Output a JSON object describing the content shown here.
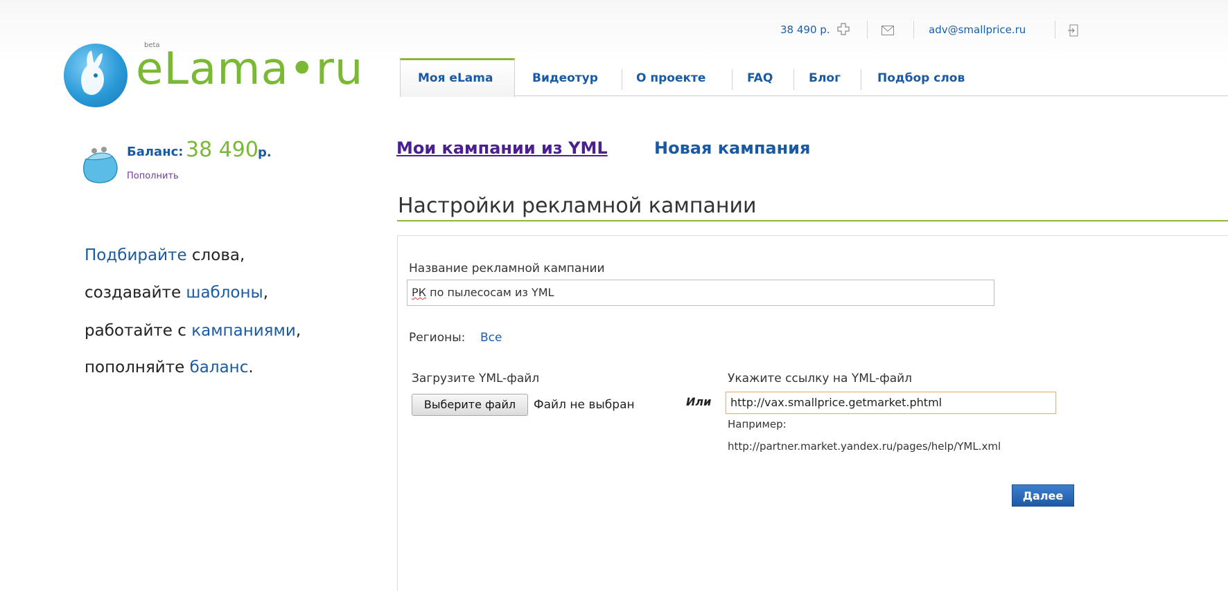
{
  "header": {
    "balance_link": "38 490 р.",
    "email": "adv@smallprice.ru"
  },
  "logo": {
    "text": "eLama•ru",
    "badge": "beta"
  },
  "nav": {
    "tabs": [
      {
        "label": "Моя eLama",
        "active": true
      },
      {
        "label": "Видеотур"
      },
      {
        "label": "О проекте"
      },
      {
        "label": "FAQ"
      },
      {
        "label": "Блог"
      },
      {
        "label": "Подбор слов"
      }
    ]
  },
  "sidebar": {
    "balance_label": "Баланс:",
    "balance_value": "38 490",
    "balance_currency": "р.",
    "topup_label": "Пополнить",
    "promo": [
      {
        "pre": "",
        "link": "Подбирайте",
        "post": " слова,"
      },
      {
        "pre": "создавайте ",
        "link": "шаблоны",
        "post": ","
      },
      {
        "pre": "работайте с ",
        "link": "кампаниями",
        "post": ","
      },
      {
        "pre": "пополняйте ",
        "link": "баланс",
        "post": "."
      }
    ]
  },
  "subnav": {
    "active": "Мои кампании из YML",
    "new_campaign": "Новая кампания"
  },
  "page": {
    "title": "Настройки рекламной кампании"
  },
  "form": {
    "name_label": "Название рекламной кампании",
    "name_value_prefix": "РК",
    "name_value_rest": " по пылесосам из YML",
    "regions_label": "Регионы:",
    "regions_value": "Все",
    "upload_label": "Загрузите YML-файл",
    "file_button": "Выберите файл",
    "file_status": "Файл не выбран",
    "or_label": "Или",
    "url_label": "Укажите ссылку на YML-файл",
    "url_value": "http://vax.smallprice.getmarket.phtml",
    "example_label": "Например:",
    "example_url": "http://partner.market.yandex.ru/pages/help/YML.xml",
    "next_button": "Далее"
  },
  "colors": {
    "accent_green": "#8cb53a",
    "link_blue": "#1a5aa3",
    "button_blue": "#1d5aa5"
  }
}
